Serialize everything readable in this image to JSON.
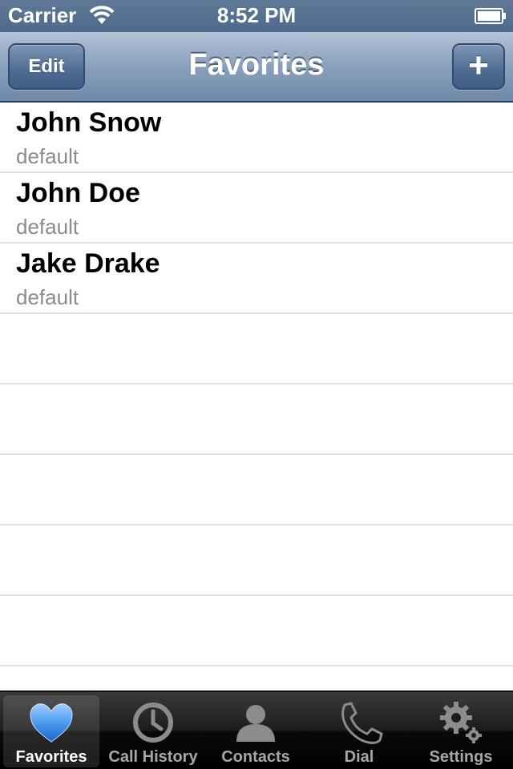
{
  "status_bar": {
    "carrier": "Carrier",
    "time": "8:52 PM"
  },
  "nav": {
    "title": "Favorites",
    "edit_label": "Edit",
    "add_label": "+"
  },
  "favorites": [
    {
      "name": "John Snow",
      "label": "default"
    },
    {
      "name": "John Doe",
      "label": "default"
    },
    {
      "name": "Jake Drake",
      "label": "default"
    }
  ],
  "tab_bar": {
    "tabs": [
      {
        "label": "Favorites",
        "icon": "heart-icon",
        "active": true
      },
      {
        "label": "Call History",
        "icon": "clock-icon",
        "active": false
      },
      {
        "label": "Contacts",
        "icon": "person-icon",
        "active": false
      },
      {
        "label": "Dial",
        "icon": "phone-icon",
        "active": false
      },
      {
        "label": "Settings",
        "icon": "gear-icon",
        "active": false
      }
    ]
  },
  "colors": {
    "nav_bar": "#6f88a9",
    "active_icon": "#4a9af0",
    "inactive_icon": "#8c8c8c"
  }
}
